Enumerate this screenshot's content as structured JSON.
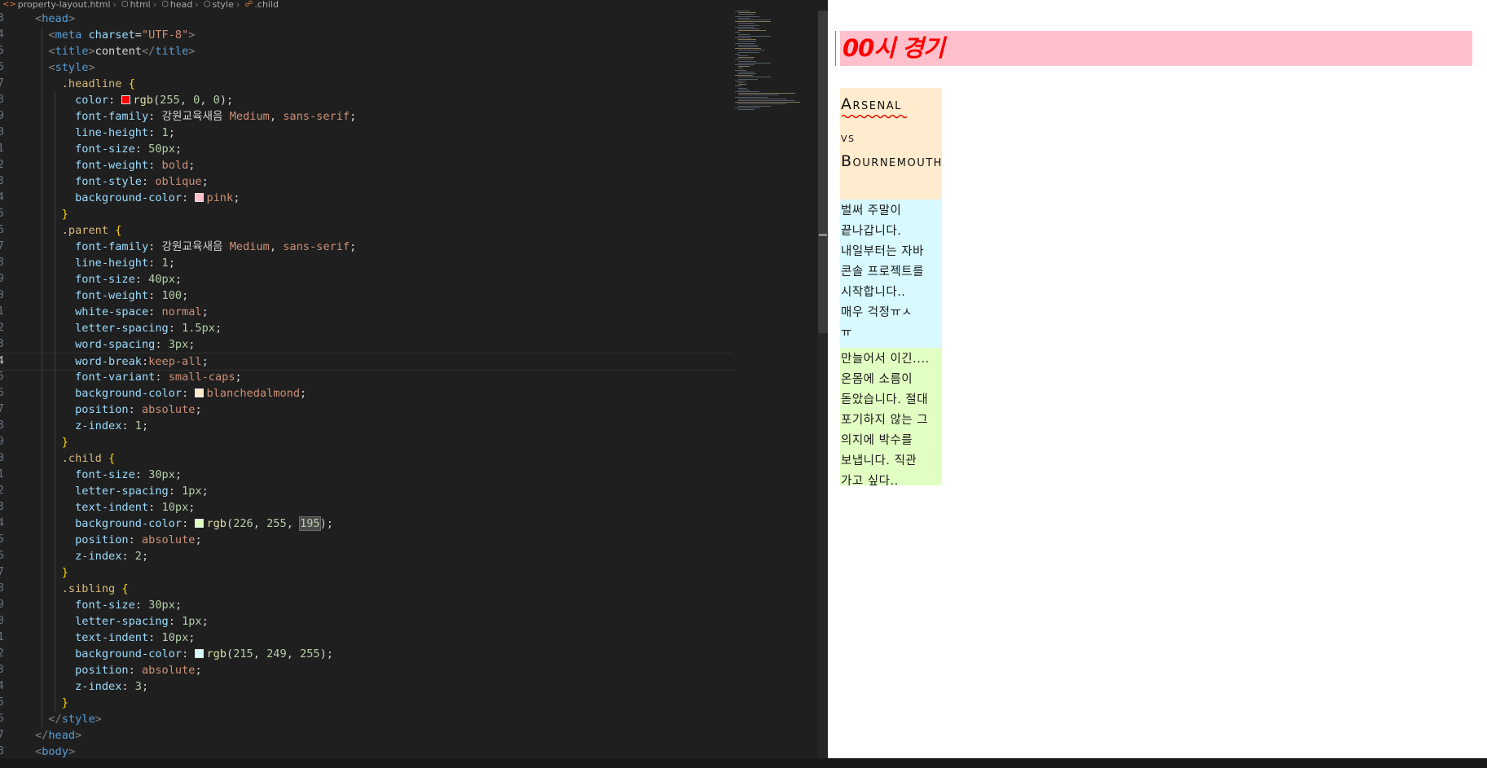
{
  "breadcrumb": {
    "file": "property-layout.html",
    "path": [
      "html",
      "head",
      "style"
    ],
    "current": ".child"
  },
  "editor": {
    "current_line": 24,
    "code": [
      {
        "n": "3",
        "tokens": [
          {
            "t": "<",
            "c": "t-br"
          },
          {
            "t": "head",
            "c": "t-tag"
          },
          {
            "t": ">",
            "c": "t-br"
          }
        ]
      },
      {
        "n": "4",
        "tokens": [
          {
            "t": "  "
          },
          {
            "t": "<",
            "c": "t-br"
          },
          {
            "t": "meta",
            "c": "t-tag"
          },
          {
            "t": " "
          },
          {
            "t": "charset",
            "c": "t-attr"
          },
          {
            "t": "=",
            "c": "t-txt"
          },
          {
            "t": "\"UTF-8\"",
            "c": "t-str"
          },
          {
            "t": ">",
            "c": "t-br"
          }
        ]
      },
      {
        "n": "5",
        "tokens": [
          {
            "t": "  "
          },
          {
            "t": "<",
            "c": "t-br"
          },
          {
            "t": "title",
            "c": "t-tag"
          },
          {
            "t": ">",
            "c": "t-br"
          },
          {
            "t": "content",
            "c": "t-txt"
          },
          {
            "t": "</",
            "c": "t-br"
          },
          {
            "t": "title",
            "c": "t-tag"
          },
          {
            "t": ">",
            "c": "t-br"
          }
        ]
      },
      {
        "n": "6",
        "tokens": [
          {
            "t": "  "
          },
          {
            "t": "<",
            "c": "t-br"
          },
          {
            "t": "style",
            "c": "t-tag"
          },
          {
            "t": ">",
            "c": "t-br"
          }
        ]
      },
      {
        "n": "7",
        "tokens": [
          {
            "t": "    "
          },
          {
            "t": ".headline",
            "c": "t-sel"
          },
          {
            "t": " "
          },
          {
            "t": "{",
            "c": "t-brace"
          }
        ]
      },
      {
        "n": "8",
        "tokens": [
          {
            "t": "      "
          },
          {
            "t": "color",
            "c": "t-prop"
          },
          {
            "t": ": "
          },
          {
            "sw": "#ff0000"
          },
          {
            "t": "rgb",
            "c": "t-fn"
          },
          {
            "t": "(",
            "c": "t-txt"
          },
          {
            "t": "255",
            "c": "t-num"
          },
          {
            "t": ", "
          },
          {
            "t": "0",
            "c": "t-num"
          },
          {
            "t": ", "
          },
          {
            "t": "0",
            "c": "t-num"
          },
          {
            "t": ");",
            "c": "t-txt"
          }
        ]
      },
      {
        "n": "9",
        "tokens": [
          {
            "t": "      "
          },
          {
            "t": "font-family",
            "c": "t-prop"
          },
          {
            "t": ": "
          },
          {
            "t": "강원교육새음",
            "c": "t-txt"
          },
          {
            "t": " "
          },
          {
            "t": "Medium",
            "c": "t-val"
          },
          {
            "t": ", "
          },
          {
            "t": "sans-serif",
            "c": "t-val"
          },
          {
            "t": ";",
            "c": "t-txt"
          }
        ]
      },
      {
        "n": "10",
        "tokens": [
          {
            "t": "      "
          },
          {
            "t": "line-height",
            "c": "t-prop"
          },
          {
            "t": ": "
          },
          {
            "t": "1",
            "c": "t-num"
          },
          {
            "t": ";",
            "c": "t-txt"
          }
        ]
      },
      {
        "n": "11",
        "tokens": [
          {
            "t": "      "
          },
          {
            "t": "font-size",
            "c": "t-prop"
          },
          {
            "t": ": "
          },
          {
            "t": "50px",
            "c": "t-num"
          },
          {
            "t": ";",
            "c": "t-txt"
          }
        ]
      },
      {
        "n": "12",
        "tokens": [
          {
            "t": "      "
          },
          {
            "t": "font-weight",
            "c": "t-prop"
          },
          {
            "t": ": "
          },
          {
            "t": "bold",
            "c": "t-val"
          },
          {
            "t": ";",
            "c": "t-txt"
          }
        ]
      },
      {
        "n": "13",
        "tokens": [
          {
            "t": "      "
          },
          {
            "t": "font-style",
            "c": "t-prop"
          },
          {
            "t": ": "
          },
          {
            "t": "oblique",
            "c": "t-val"
          },
          {
            "t": ";",
            "c": "t-txt"
          }
        ]
      },
      {
        "n": "14",
        "tokens": [
          {
            "t": "      "
          },
          {
            "t": "background-color",
            "c": "t-prop"
          },
          {
            "t": ": "
          },
          {
            "sw": "#ffc0cb"
          },
          {
            "t": "pink",
            "c": "t-val"
          },
          {
            "t": ";",
            "c": "t-txt"
          }
        ]
      },
      {
        "n": "15",
        "tokens": [
          {
            "t": "    "
          },
          {
            "t": "}",
            "c": "t-brace"
          }
        ]
      },
      {
        "n": "16",
        "tokens": [
          {
            "t": "    "
          },
          {
            "t": ".parent",
            "c": "t-sel"
          },
          {
            "t": " "
          },
          {
            "t": "{",
            "c": "t-brace"
          }
        ]
      },
      {
        "n": "17",
        "tokens": [
          {
            "t": "      "
          },
          {
            "t": "font-family",
            "c": "t-prop"
          },
          {
            "t": ": "
          },
          {
            "t": "강원교육새음",
            "c": "t-txt"
          },
          {
            "t": " "
          },
          {
            "t": "Medium",
            "c": "t-val"
          },
          {
            "t": ", "
          },
          {
            "t": "sans-serif",
            "c": "t-val"
          },
          {
            "t": ";",
            "c": "t-txt"
          }
        ]
      },
      {
        "n": "18",
        "tokens": [
          {
            "t": "      "
          },
          {
            "t": "line-height",
            "c": "t-prop"
          },
          {
            "t": ": "
          },
          {
            "t": "1",
            "c": "t-num"
          },
          {
            "t": ";",
            "c": "t-txt"
          }
        ]
      },
      {
        "n": "19",
        "tokens": [
          {
            "t": "      "
          },
          {
            "t": "font-size",
            "c": "t-prop"
          },
          {
            "t": ": "
          },
          {
            "t": "40px",
            "c": "t-num"
          },
          {
            "t": ";",
            "c": "t-txt"
          }
        ]
      },
      {
        "n": "20",
        "tokens": [
          {
            "t": "      "
          },
          {
            "t": "font-weight",
            "c": "t-prop"
          },
          {
            "t": ": "
          },
          {
            "t": "100",
            "c": "t-num"
          },
          {
            "t": ";",
            "c": "t-txt"
          }
        ]
      },
      {
        "n": "21",
        "tokens": [
          {
            "t": "      "
          },
          {
            "t": "white-space",
            "c": "t-prop"
          },
          {
            "t": ": "
          },
          {
            "t": "normal",
            "c": "t-val"
          },
          {
            "t": ";",
            "c": "t-txt"
          }
        ]
      },
      {
        "n": "22",
        "tokens": [
          {
            "t": "      "
          },
          {
            "t": "letter-spacing",
            "c": "t-prop"
          },
          {
            "t": ": "
          },
          {
            "t": "1.5px",
            "c": "t-num"
          },
          {
            "t": ";",
            "c": "t-txt"
          }
        ]
      },
      {
        "n": "23",
        "tokens": [
          {
            "t": "      "
          },
          {
            "t": "word-spacing",
            "c": "t-prop"
          },
          {
            "t": ": "
          },
          {
            "t": "3px",
            "c": "t-num"
          },
          {
            "t": ";",
            "c": "t-txt"
          }
        ]
      },
      {
        "n": "24",
        "tokens": [
          {
            "t": "      "
          },
          {
            "t": "word-break",
            "c": "t-prop"
          },
          {
            "t": ":"
          },
          {
            "t": "keep-all",
            "c": "t-val"
          },
          {
            "t": ";",
            "c": "t-txt"
          }
        ]
      },
      {
        "n": "25",
        "tokens": [
          {
            "t": "      "
          },
          {
            "t": "font-variant",
            "c": "t-prop"
          },
          {
            "t": ": "
          },
          {
            "t": "small-caps",
            "c": "t-val"
          },
          {
            "t": ";",
            "c": "t-txt"
          }
        ]
      },
      {
        "n": "26",
        "tokens": [
          {
            "t": "      "
          },
          {
            "t": "background-color",
            "c": "t-prop"
          },
          {
            "t": ": "
          },
          {
            "sw": "#ffebcd"
          },
          {
            "t": "blanchedalmond",
            "c": "t-val"
          },
          {
            "t": ";",
            "c": "t-txt"
          }
        ]
      },
      {
        "n": "27",
        "tokens": [
          {
            "t": "      "
          },
          {
            "t": "position",
            "c": "t-prop"
          },
          {
            "t": ": "
          },
          {
            "t": "absolute",
            "c": "t-val"
          },
          {
            "t": ";",
            "c": "t-txt"
          }
        ]
      },
      {
        "n": "28",
        "tokens": [
          {
            "t": "      "
          },
          {
            "t": "z-index",
            "c": "t-prop"
          },
          {
            "t": ": "
          },
          {
            "t": "1",
            "c": "t-num"
          },
          {
            "t": ";",
            "c": "t-txt"
          }
        ]
      },
      {
        "n": "29",
        "tokens": [
          {
            "t": "    "
          },
          {
            "t": "}",
            "c": "t-brace"
          }
        ]
      },
      {
        "n": "30",
        "tokens": [
          {
            "t": "    "
          },
          {
            "t": ".child",
            "c": "t-sel"
          },
          {
            "t": " "
          },
          {
            "t": "{",
            "c": "t-brace"
          }
        ]
      },
      {
        "n": "31",
        "tokens": [
          {
            "t": "      "
          },
          {
            "t": "font-size",
            "c": "t-prop"
          },
          {
            "t": ": "
          },
          {
            "t": "30px",
            "c": "t-num"
          },
          {
            "t": ";",
            "c": "t-txt"
          }
        ]
      },
      {
        "n": "32",
        "tokens": [
          {
            "t": "      "
          },
          {
            "t": "letter-spacing",
            "c": "t-prop"
          },
          {
            "t": ": "
          },
          {
            "t": "1px",
            "c": "t-num"
          },
          {
            "t": ";",
            "c": "t-txt"
          }
        ]
      },
      {
        "n": "33",
        "tokens": [
          {
            "t": "      "
          },
          {
            "t": "text-indent",
            "c": "t-prop"
          },
          {
            "t": ": "
          },
          {
            "t": "10px",
            "c": "t-num"
          },
          {
            "t": ";",
            "c": "t-txt"
          }
        ]
      },
      {
        "n": "34",
        "tokens": [
          {
            "t": "      "
          },
          {
            "t": "background-color",
            "c": "t-prop"
          },
          {
            "t": ": "
          },
          {
            "sw": "#e2ffc3"
          },
          {
            "t": "rgb",
            "c": "t-fn"
          },
          {
            "t": "(",
            "c": "t-txt"
          },
          {
            "t": "226",
            "c": "t-num"
          },
          {
            "t": ", "
          },
          {
            "t": "255",
            "c": "t-num"
          },
          {
            "t": ", "
          },
          {
            "t": "195",
            "c": "t-num t-hl"
          },
          {
            "t": ");",
            "c": "t-txt"
          }
        ]
      },
      {
        "n": "35",
        "tokens": [
          {
            "t": "      "
          },
          {
            "t": "position",
            "c": "t-prop"
          },
          {
            "t": ": "
          },
          {
            "t": "absolute",
            "c": "t-val"
          },
          {
            "t": ";",
            "c": "t-txt"
          }
        ]
      },
      {
        "n": "36",
        "tokens": [
          {
            "t": "      "
          },
          {
            "t": "z-index",
            "c": "t-prop"
          },
          {
            "t": ": "
          },
          {
            "t": "2",
            "c": "t-num"
          },
          {
            "t": ";",
            "c": "t-txt"
          }
        ]
      },
      {
        "n": "37",
        "tokens": [
          {
            "t": "    "
          },
          {
            "t": "}",
            "c": "t-brace"
          }
        ]
      },
      {
        "n": "38",
        "tokens": [
          {
            "t": "    "
          },
          {
            "t": ".sibling",
            "c": "t-sel"
          },
          {
            "t": " "
          },
          {
            "t": "{",
            "c": "t-brace"
          }
        ]
      },
      {
        "n": "39",
        "tokens": [
          {
            "t": "      "
          },
          {
            "t": "font-size",
            "c": "t-prop"
          },
          {
            "t": ": "
          },
          {
            "t": "30px",
            "c": "t-num"
          },
          {
            "t": ";",
            "c": "t-txt"
          }
        ]
      },
      {
        "n": "40",
        "tokens": [
          {
            "t": "      "
          },
          {
            "t": "letter-spacing",
            "c": "t-prop"
          },
          {
            "t": ": "
          },
          {
            "t": "1px",
            "c": "t-num"
          },
          {
            "t": ";",
            "c": "t-txt"
          }
        ]
      },
      {
        "n": "41",
        "tokens": [
          {
            "t": "      "
          },
          {
            "t": "text-indent",
            "c": "t-prop"
          },
          {
            "t": ": "
          },
          {
            "t": "10px",
            "c": "t-num"
          },
          {
            "t": ";",
            "c": "t-txt"
          }
        ]
      },
      {
        "n": "42",
        "tokens": [
          {
            "t": "      "
          },
          {
            "t": "background-color",
            "c": "t-prop"
          },
          {
            "t": ": "
          },
          {
            "sw": "#d7f9ff"
          },
          {
            "t": "rgb",
            "c": "t-fn"
          },
          {
            "t": "(",
            "c": "t-txt"
          },
          {
            "t": "215",
            "c": "t-num"
          },
          {
            "t": ", "
          },
          {
            "t": "249",
            "c": "t-num"
          },
          {
            "t": ", "
          },
          {
            "t": "255",
            "c": "t-num"
          },
          {
            "t": ");",
            "c": "t-txt"
          }
        ]
      },
      {
        "n": "43",
        "tokens": [
          {
            "t": "      "
          },
          {
            "t": "position",
            "c": "t-prop"
          },
          {
            "t": ": "
          },
          {
            "t": "absolute",
            "c": "t-val"
          },
          {
            "t": ";",
            "c": "t-txt"
          }
        ]
      },
      {
        "n": "44",
        "tokens": [
          {
            "t": "      "
          },
          {
            "t": "z-index",
            "c": "t-prop"
          },
          {
            "t": ": "
          },
          {
            "t": "3",
            "c": "t-num"
          },
          {
            "t": ";",
            "c": "t-txt"
          }
        ]
      },
      {
        "n": "45",
        "tokens": [
          {
            "t": "    "
          },
          {
            "t": "}",
            "c": "t-brace"
          }
        ]
      },
      {
        "n": "46",
        "tokens": [
          {
            "t": "  "
          },
          {
            "t": "</",
            "c": "t-br"
          },
          {
            "t": "style",
            "c": "t-tag"
          },
          {
            "t": ">",
            "c": "t-br"
          }
        ]
      },
      {
        "n": "47",
        "tokens": [
          {
            "t": "</",
            "c": "t-br"
          },
          {
            "t": "head",
            "c": "t-tag"
          },
          {
            "t": ">",
            "c": "t-br"
          }
        ]
      },
      {
        "n": "48",
        "tokens": [
          {
            "t": "<",
            "c": "t-br"
          },
          {
            "t": "body",
            "c": "t-tag"
          },
          {
            "t": ">",
            "c": "t-br"
          }
        ]
      }
    ]
  },
  "preview": {
    "headline": "00시 경기",
    "match": {
      "home": "Arsenal",
      "vs": "vs",
      "away": "Bournemouth"
    },
    "sibling_lines": [
      " 벌써 주말이",
      "끝나갑니다.",
      "내일부터는 자바",
      "콘솔 프로젝트를",
      "시작합니다..",
      "매우 걱정ㅠㅅ",
      "ㅠ"
    ],
    "child_lines": [
      "만늘어서 이긴....",
      "온몸에 소름이",
      "돋았습니다. 절대",
      "포기하지 않는 그",
      "의지에 박수를",
      "보냅니다. 직관",
      "가고 싶다.."
    ],
    "colors": {
      "headline_bg": "#ffc0cb",
      "headline_text": "#ff0000",
      "parent_bg": "#ffebcd",
      "sibling_bg": "#d7f9ff",
      "child_bg": "#e2ffc3",
      "spell_underline": "#e51400"
    }
  }
}
